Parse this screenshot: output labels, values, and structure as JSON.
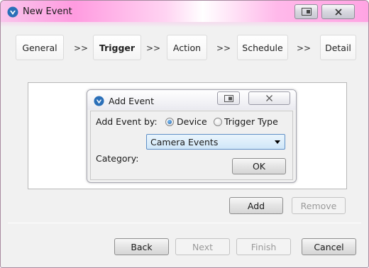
{
  "window": {
    "title": "New Event",
    "restore_icon": "restore-icon",
    "close_icon": "close-x-icon"
  },
  "steps": [
    {
      "label": "General",
      "active": false
    },
    {
      "label": "Trigger",
      "active": true
    },
    {
      "label": "Action",
      "active": false
    },
    {
      "label": "Schedule",
      "active": false
    },
    {
      "label": "Detail",
      "active": false
    }
  ],
  "step_separator": ">>",
  "dialog": {
    "title": "Add Event",
    "add_event_by_label": "Add Event by:",
    "radio_device": "Device",
    "radio_trigger_type": "Trigger Type",
    "selected_radio": "Device",
    "category_label": "Category:",
    "category_value": "Camera Events",
    "ok_label": "OK"
  },
  "actions": {
    "add": "Add",
    "remove": "Remove"
  },
  "footer": {
    "back": "Back",
    "next": "Next",
    "finish": "Finish",
    "cancel": "Cancel"
  },
  "colors": {
    "titlebar_accent": "#ff9be0",
    "select_bg": "#cfe6f8",
    "radio_dot": "#1c5fa8"
  }
}
